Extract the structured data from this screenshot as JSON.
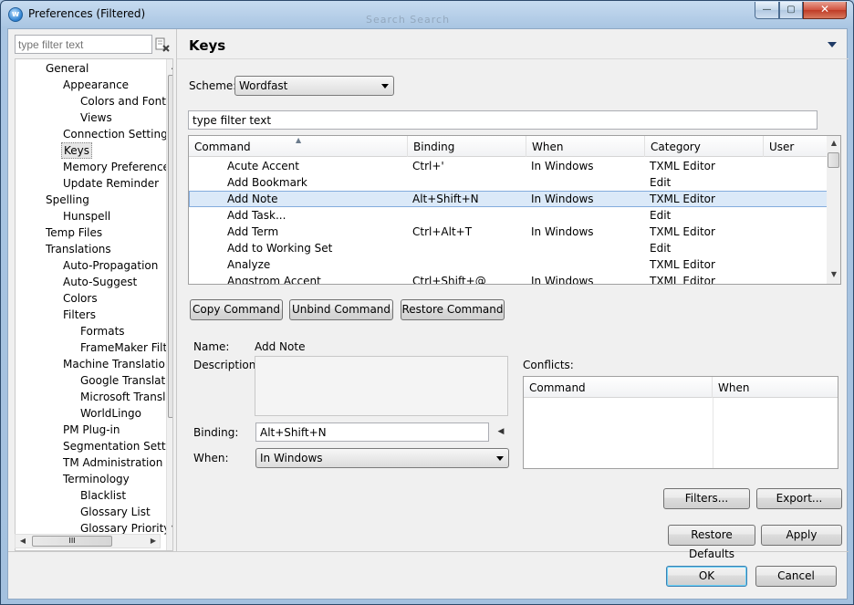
{
  "window": {
    "title": "Preferences (Filtered)",
    "ghost_title": "Search Search",
    "controls": {
      "minimize": "—",
      "maximize": "▢",
      "close": "✕"
    }
  },
  "left": {
    "filter_placeholder": "type filter text",
    "tree": [
      {
        "label": "General",
        "level": 0
      },
      {
        "label": "Appearance",
        "level": 1
      },
      {
        "label": "Colors and Fonts",
        "level": 2
      },
      {
        "label": "Views",
        "level": 2
      },
      {
        "label": "Connection Settings",
        "level": 1
      },
      {
        "label": "Keys",
        "level": 1,
        "selected": true
      },
      {
        "label": "Memory Preferences",
        "level": 1
      },
      {
        "label": "Update Reminder",
        "level": 1
      },
      {
        "label": "Spelling",
        "level": 0
      },
      {
        "label": "Hunspell",
        "level": 1
      },
      {
        "label": "Temp Files",
        "level": 0
      },
      {
        "label": "Translations",
        "level": 0
      },
      {
        "label": "Auto-Propagation",
        "level": 1
      },
      {
        "label": "Auto-Suggest",
        "level": 1
      },
      {
        "label": "Colors",
        "level": 1
      },
      {
        "label": "Filters",
        "level": 1
      },
      {
        "label": "Formats",
        "level": 2
      },
      {
        "label": "FrameMaker Filter",
        "level": 2
      },
      {
        "label": "Machine Translation",
        "level": 1
      },
      {
        "label": "Google Translate",
        "level": 2
      },
      {
        "label": "Microsoft Translat",
        "level": 2
      },
      {
        "label": "WorldLingo",
        "level": 2
      },
      {
        "label": "PM Plug-in",
        "level": 1
      },
      {
        "label": "Segmentation Setting",
        "level": 1
      },
      {
        "label": "TM Administration",
        "level": 1
      },
      {
        "label": "Terminology",
        "level": 1
      },
      {
        "label": "Blacklist",
        "level": 2
      },
      {
        "label": "Glossary List",
        "level": 2
      },
      {
        "label": "Glossary Priority",
        "level": 2
      }
    ],
    "hscroll_grip": "III"
  },
  "keys": {
    "title": "Keys",
    "scheme_label": "Scheme:",
    "scheme_value": "Wordfast",
    "filter_value": "type filter text",
    "columns": [
      "Command",
      "Binding",
      "When",
      "Category",
      "User"
    ],
    "rows": [
      {
        "command": "Acute Accent",
        "binding": "Ctrl+'",
        "when": "In Windows",
        "category": "TXML Editor",
        "user": ""
      },
      {
        "command": "Add Bookmark",
        "binding": "",
        "when": "",
        "category": "Edit",
        "user": ""
      },
      {
        "command": "Add Note",
        "binding": "Alt+Shift+N",
        "when": "In Windows",
        "category": "TXML Editor",
        "user": "",
        "selected": true
      },
      {
        "command": "Add Task...",
        "binding": "",
        "when": "",
        "category": "Edit",
        "user": ""
      },
      {
        "command": "Add Term",
        "binding": "Ctrl+Alt+T",
        "when": "In Windows",
        "category": "TXML Editor",
        "user": ""
      },
      {
        "command": "Add to Working Set",
        "binding": "",
        "when": "",
        "category": "Edit",
        "user": ""
      },
      {
        "command": "Analyze",
        "binding": "",
        "when": "",
        "category": "TXML Editor",
        "user": ""
      },
      {
        "command": "Angstrom Accent",
        "binding": "Ctrl+Shift+@",
        "when": "In Windows",
        "category": "TXML Editor",
        "user": ""
      }
    ],
    "buttons": {
      "copy": "Copy Command",
      "unbind": "Unbind Command",
      "restore": "Restore Command"
    },
    "name_label": "Name:",
    "name_value": "Add Note",
    "description_label": "Description:",
    "binding_label": "Binding:",
    "binding_value": "Alt+Shift+N",
    "when_label": "When:",
    "when_value": "In Windows",
    "conflicts_label": "Conflicts:",
    "conflict_columns": [
      "Command",
      "When"
    ],
    "filters_button": "Filters...",
    "export_button": "Export..."
  },
  "footer": {
    "restore_defaults": "Restore Defaults",
    "apply": "Apply",
    "ok": "OK",
    "cancel": "Cancel"
  }
}
